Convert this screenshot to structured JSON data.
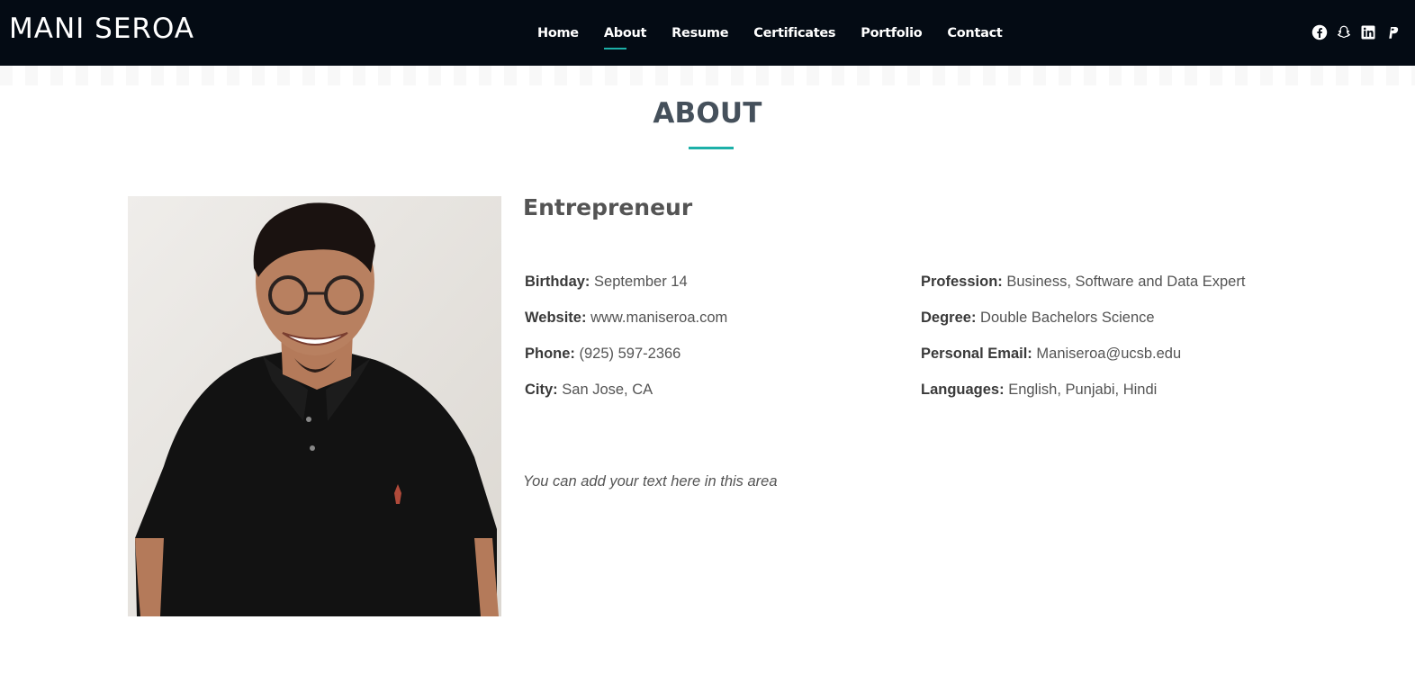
{
  "header": {
    "logo": "MANI SEROA",
    "nav": [
      "Home",
      "About",
      "Resume",
      "Certificates",
      "Portfolio",
      "Contact"
    ],
    "active_nav": "About",
    "social_icons": [
      "facebook-icon",
      "snapchat-icon",
      "linkedin-icon",
      "paypal-icon"
    ]
  },
  "section": {
    "title": "ABOUT",
    "accent_color": "#1cb0a8"
  },
  "profile": {
    "role": "Entrepreneur",
    "left_details": [
      {
        "label": "Birthday:",
        "value": "September 14"
      },
      {
        "label": "Website:",
        "value": "www.maniseroa.com"
      },
      {
        "label": "Phone:",
        "value": "(925) 597-2366"
      },
      {
        "label": "City:",
        "value": "San Jose, CA"
      }
    ],
    "right_details": [
      {
        "label": "Profession:",
        "value": "Business, Software and Data Expert"
      },
      {
        "label": "Degree:",
        "value": "Double Bachelors Science"
      },
      {
        "label": "Personal Email:",
        "value": "Maniseroa@ucsb.edu"
      },
      {
        "label": "Languages:",
        "value": "English, Punjabi, Hindi"
      }
    ],
    "note": "You can add your text here in this area"
  },
  "colors": {
    "header_bg": "#040b14",
    "accent": "#1cb0a8"
  }
}
